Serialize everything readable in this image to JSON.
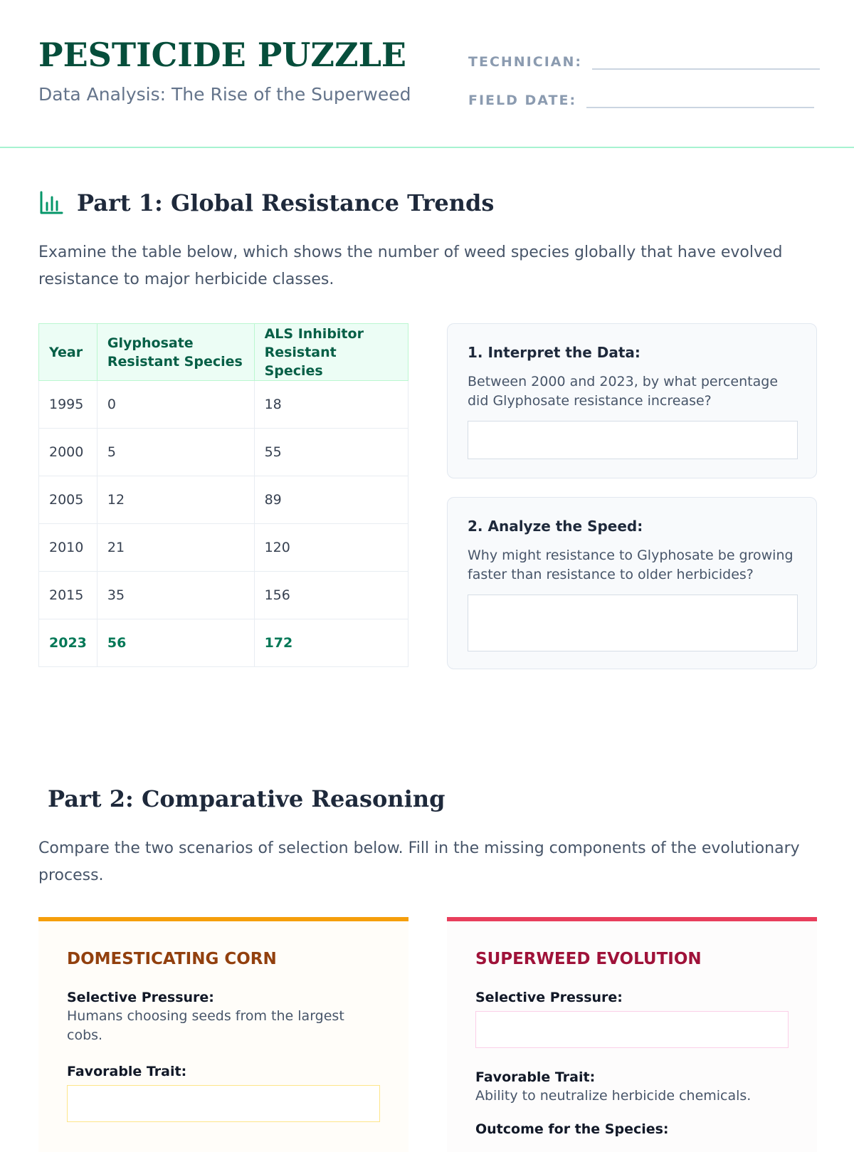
{
  "header": {
    "title": "PESTICIDE PUZZLE",
    "subtitle": "Data Analysis: The Rise of the Superweed",
    "technician_label": "TECHNICIAN:",
    "field_date_label": "FIELD DATE:"
  },
  "part1": {
    "heading": "Part 1: Global Resistance Trends",
    "icon": "bar-chart-icon",
    "intro": "Examine the table below, which shows the number of weed species globally that have evolved resistance to major herbicide classes.",
    "table": {
      "headers": [
        "Year",
        "Glyphosate Resistant Species",
        "ALS Inhibitor Resistant Species"
      ],
      "rows": [
        [
          "1995",
          "0",
          "18"
        ],
        [
          "2000",
          "5",
          "55"
        ],
        [
          "2005",
          "12",
          "89"
        ],
        [
          "2010",
          "21",
          "120"
        ],
        [
          "2015",
          "35",
          "156"
        ],
        [
          "2023",
          "56",
          "172"
        ]
      ]
    },
    "questions": [
      {
        "title": "1. Interpret the Data:",
        "text": "Between 2000 and 2023, by what percentage did Glyphosate resistance increase?"
      },
      {
        "title": "2. Analyze the Speed:",
        "text": "Why might resistance to Glyphosate be growing faster than resistance to older herbicides?"
      }
    ]
  },
  "part2": {
    "heading": "Part 2: Comparative Reasoning",
    "intro": "Compare the two scenarios of selection below. Fill in the missing components of the evolutionary process.",
    "corn": {
      "title": "DOMESTICATING CORN",
      "pressure_label": "Selective Pressure:",
      "pressure_text": "Humans choosing seeds from the largest cobs.",
      "trait_label": "Favorable Trait:"
    },
    "weed": {
      "title": "SUPERWEED EVOLUTION",
      "pressure_label": "Selective Pressure:",
      "trait_label": "Favorable Trait:",
      "trait_text": "Ability to neutralize herbicide chemicals.",
      "outcome_label": "Outcome for the Species:"
    }
  },
  "colors": {
    "brand_green": "#064e3b",
    "accent_green": "#047857",
    "corn_accent": "#f59e0b",
    "weed_accent": "#e83e5c"
  }
}
